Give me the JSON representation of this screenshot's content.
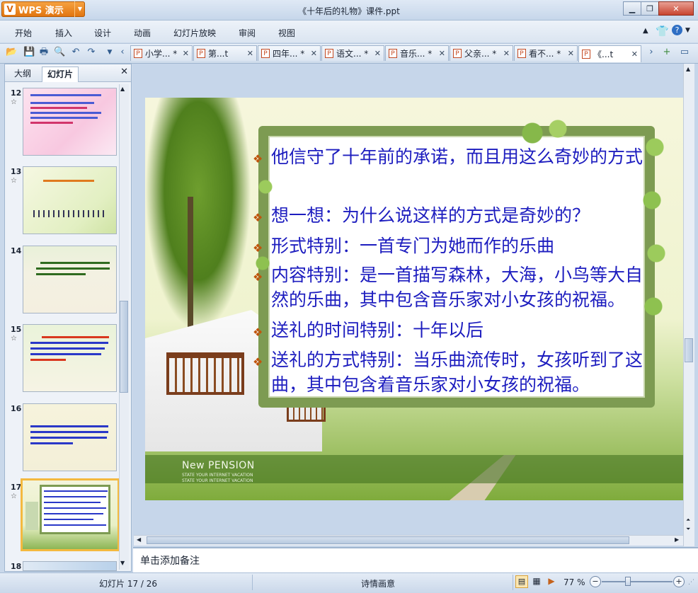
{
  "window": {
    "app_name": "WPS 演示",
    "app_logo_letter": "V",
    "document_title": "《十年后的礼物》课件.ppt"
  },
  "menu": [
    "开始",
    "插入",
    "设计",
    "动画",
    "幻灯片放映",
    "审阅",
    "视图"
  ],
  "doc_tabs": [
    {
      "label": "小学... *"
    },
    {
      "label": "第...t"
    },
    {
      "label": "四年... *"
    },
    {
      "label": "语文... *"
    },
    {
      "label": "音乐... *"
    },
    {
      "label": "父亲... *"
    },
    {
      "label": "看不... *"
    },
    {
      "label": "《...t"
    }
  ],
  "left_panel": {
    "tabs": [
      "大纲",
      "幻灯片"
    ],
    "active_tab": "幻灯片",
    "slides": [
      {
        "num": "12",
        "star": "☆"
      },
      {
        "num": "13",
        "star": "☆"
      },
      {
        "num": "14",
        "star": ""
      },
      {
        "num": "15",
        "star": "☆"
      },
      {
        "num": "16",
        "star": ""
      },
      {
        "num": "17",
        "star": "☆"
      },
      {
        "num": "18",
        "star": ""
      }
    ]
  },
  "slide": {
    "lines": [
      "他信守了十年前的承诺，而且用这么奇妙的方式",
      "想一想：为什么说这样的方式是奇妙的？",
      "形式特别：一首专门为她而作的乐曲",
      "内容特别：是一首描写森林，大海，小鸟等大自",
      "然的乐曲，其中包含音乐家对小女孩的祝福。",
      "送礼的时间特别：十年以后",
      "送礼的方式特别：当乐曲流传时，女孩听到了这",
      "曲，其中包含着音乐家对小女孩的祝福。"
    ],
    "bullet_symbol": "❖",
    "brand": "New PENSION",
    "brand_sub_1": "STATE YOUR INTERNET VACATION",
    "brand_sub_2": "STATE YOUR INTERNET VACATION"
  },
  "notes_placeholder": "单击添加备注",
  "status": {
    "slide_counter": "幻灯片 17 / 26",
    "theme": "诗情画意",
    "zoom": "77 %"
  },
  "colors": {
    "accent_orange": "#e0730e",
    "slide_text": "#1d1dbf",
    "bullet": "#c1540c",
    "frame_green": "#7d9b52"
  }
}
